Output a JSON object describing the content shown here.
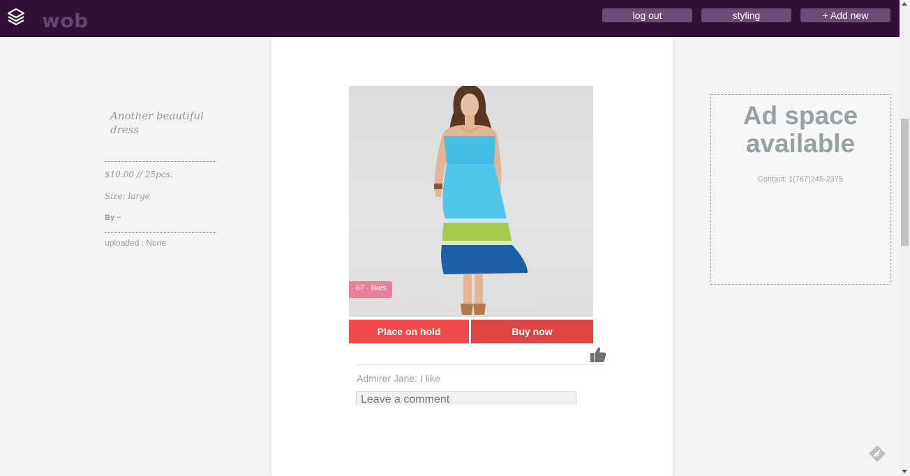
{
  "app": {
    "brand": "wob"
  },
  "topbar": {
    "logout_label": "log out",
    "styling_label": "styling",
    "add_label": "+ Add new"
  },
  "item": {
    "title": "Another beautiful dress",
    "price": "$10.00 // 25pcs.",
    "size": "Size: large",
    "by": "By ~",
    "uploaded": "uploaded : None",
    "likes": "- 67 - likes"
  },
  "actions": {
    "hold_label": "Place on hold",
    "buy_label": "Buy now"
  },
  "comments": {
    "items": [
      {
        "text": "Admirer Jane: I like"
      }
    ],
    "input_placeholder": "Leave a comment"
  },
  "ad": {
    "title": "Ad space available",
    "contact": "Contact: 1(767)245-2375"
  },
  "icons": {
    "menu": "layers-icon",
    "like": "thumbs-up-icon",
    "widget": "feather-icon"
  },
  "colors": {
    "topbar_bg": "#320f37",
    "topbar_button": "#6e4a78",
    "hold_button": "#f24a4a",
    "buy_button": "#e04545",
    "likes_badge": "#e87f98"
  }
}
